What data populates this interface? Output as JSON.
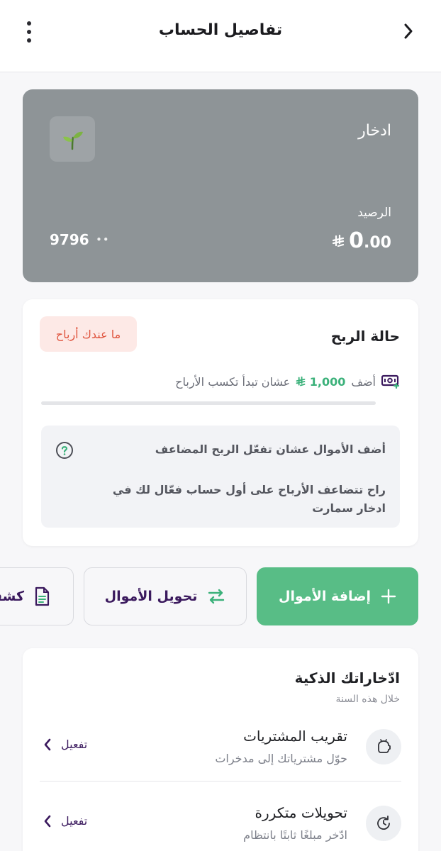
{
  "header": {
    "title": "تفاصيل الحساب"
  },
  "account": {
    "name": "ادخار",
    "balance_label": "الرصيد",
    "balance_int": "0",
    "balance_dec": ".00",
    "currency_symbol": "⃁",
    "account_dots": "••",
    "account_last4": "9796",
    "card_color": "#8e9497"
  },
  "profit": {
    "title": "حالة الربح",
    "badge": "ما عندك أرباح",
    "hint_prefix": "أضف",
    "hint_amount": "1,000",
    "hint_suffix": "عشان تبدأ تكسب الأرباح",
    "progress": 0,
    "info_title": "أضف الأموال عشان تفعّل الربح المضاعف",
    "info_body": "راح تتضاعف الأرباح على أول حساب فعّال لك في ادخار سمارت"
  },
  "actions": {
    "add_funds": "إضافة الأموال",
    "transfer": "تحويل الأموال",
    "statement": "كشف"
  },
  "smart_savings": {
    "title": "ادّخاراتك الذكية",
    "subtitle": "خلال هذه السنة",
    "items": [
      {
        "name": "تقريب المشتريات",
        "desc": "حوّل مشترياتك إلى مدخرات",
        "action": "تفعيل",
        "icon": "piggy-bank-icon"
      },
      {
        "name": "تحويلات متكررة",
        "desc": "ادّخر مبلغًا ثابتًا بانتظام",
        "action": "تفعيل",
        "icon": "recurring-clock-icon"
      }
    ]
  },
  "colors": {
    "accent_green": "#58bd86",
    "profit_green": "#3bb17a",
    "brand_purple": "#3b1a5e",
    "badge_red": "#e0553f"
  }
}
